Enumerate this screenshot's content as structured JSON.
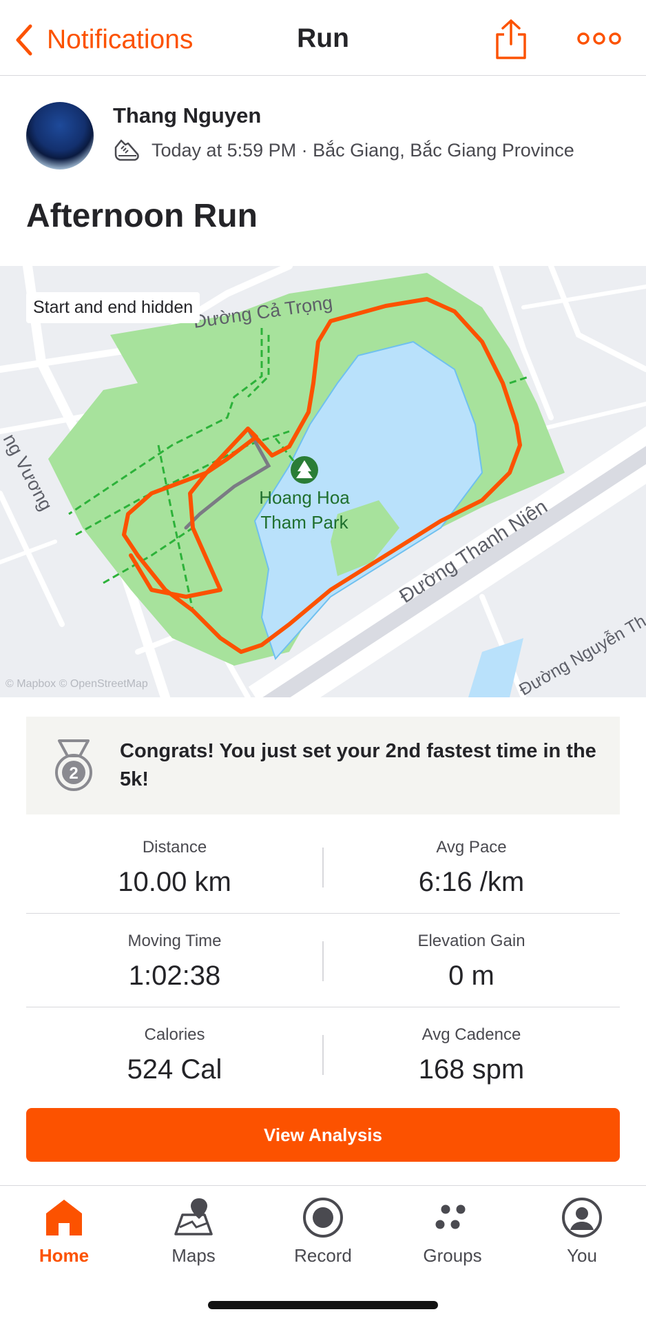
{
  "header": {
    "back_label": "Notifications",
    "title": "Run"
  },
  "athlete": {
    "name": "Thang Nguyen",
    "meta": "Today at 5:59 PM · Bắc Giang, Bắc Giang Province"
  },
  "activity": {
    "title": "Afternoon Run"
  },
  "map": {
    "privacy_label": "Start and end hidden",
    "park_name_line1": "Hoang Hoa",
    "park_name_line2": "Tham Park",
    "street_top": "Đường Cả Trọng",
    "street_right": "Đường Thanh Niên",
    "street_left": "ng Vương",
    "street_bottom_right": "Đường Nguyễn Th",
    "credit": "© Mapbox © OpenStreetMap",
    "route_color": "#fc5200",
    "park_color": "#a7e29c",
    "water_color": "#b9e1fb"
  },
  "achievement": {
    "text": "Congrats! You just set your 2nd fastest time in the 5k!",
    "medal_number": "2"
  },
  "stats": [
    {
      "left_label": "Distance",
      "left_value": "10.00 km",
      "right_label": "Avg Pace",
      "right_value": "6:16 /km"
    },
    {
      "left_label": "Moving Time",
      "left_value": "1:02:38",
      "right_label": "Elevation Gain",
      "right_value": "0 m"
    },
    {
      "left_label": "Calories",
      "left_value": "524 Cal",
      "right_label": "Avg Cadence",
      "right_value": "168 spm"
    }
  ],
  "actions": {
    "view_analysis": "View Analysis"
  },
  "tabs": [
    {
      "label": "Home",
      "icon": "home-icon",
      "active": true
    },
    {
      "label": "Maps",
      "icon": "maps-icon",
      "active": false
    },
    {
      "label": "Record",
      "icon": "record-icon",
      "active": false
    },
    {
      "label": "Groups",
      "icon": "groups-icon",
      "active": false
    },
    {
      "label": "You",
      "icon": "profile-icon",
      "active": false
    }
  ],
  "colors": {
    "brand": "#fc5200",
    "text": "#242428",
    "divider": "#d8d8dc"
  }
}
